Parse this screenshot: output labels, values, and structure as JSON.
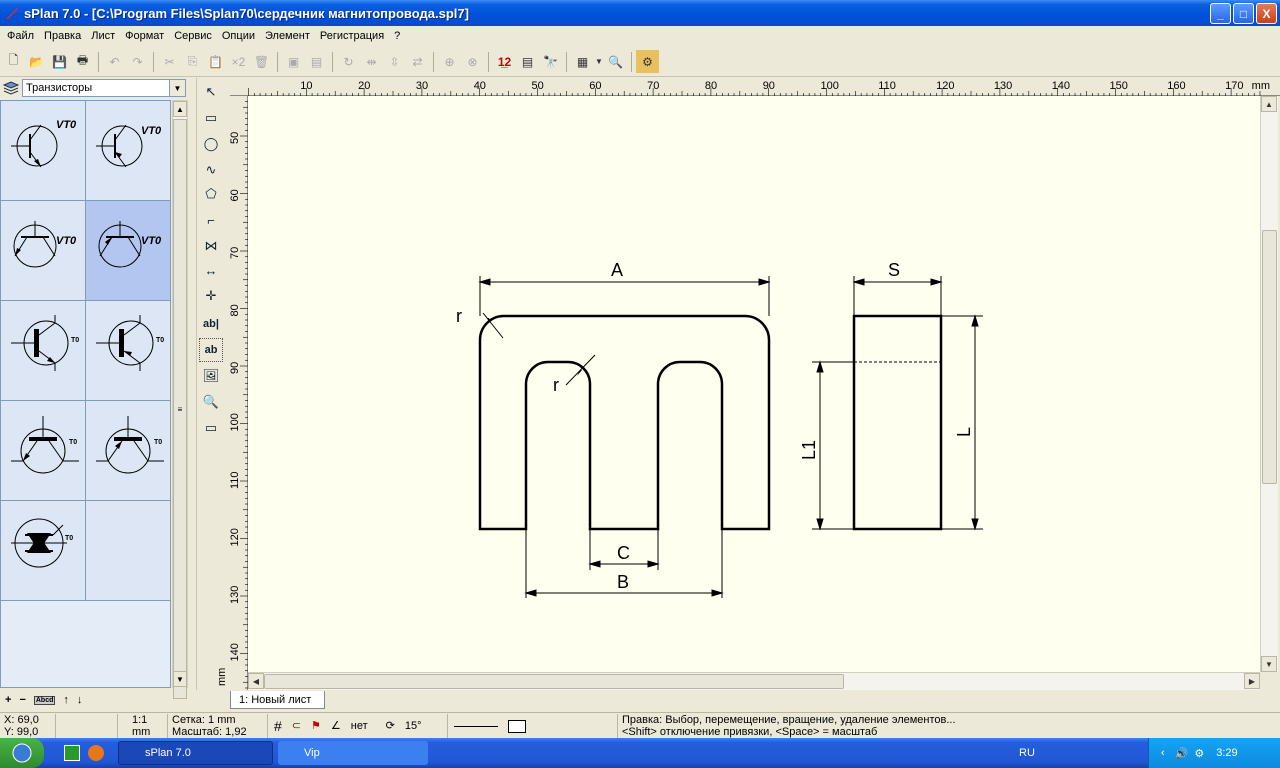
{
  "window": {
    "title": "sPlan 7.0 - [C:\\Program Files\\Splan70\\сердечник магнитопровода.spl7]",
    "min": "_",
    "max": "□",
    "close": "X"
  },
  "menu": [
    "Файл",
    "Правка",
    "Лист",
    "Формат",
    "Сервис",
    "Опции",
    "Элемент",
    "Регистрация",
    "?"
  ],
  "library": {
    "selected": "Транзисторы",
    "cells": [
      {
        "label": "VT0",
        "small": false
      },
      {
        "label": "VT0",
        "small": false
      },
      {
        "label": "VT0",
        "small": false
      },
      {
        "label": "VT0",
        "small": false
      },
      {
        "label": "T0",
        "small": true
      },
      {
        "label": "T0",
        "small": true
      },
      {
        "label": "T0",
        "small": true
      },
      {
        "label": "T0",
        "small": true
      },
      {
        "label": "T0",
        "small": true
      }
    ],
    "footer": [
      "+",
      "−",
      "Abcd",
      "↑",
      "↓"
    ]
  },
  "hruler": {
    "unit": "mm",
    "ticks": [
      "10",
      "20",
      "30",
      "40",
      "50",
      "60",
      "70",
      "80",
      "90",
      "100",
      "110",
      "120",
      "130",
      "140",
      "150",
      "160",
      "170"
    ]
  },
  "vruler": {
    "unit": "mm",
    "ticks": [
      "50",
      "60",
      "70",
      "80",
      "90",
      "100",
      "110",
      "120",
      "130",
      "140"
    ]
  },
  "drawing": {
    "labels": {
      "A": "A",
      "S": "S",
      "r1": "r",
      "r2": "r",
      "C": "C",
      "B": "B",
      "L1": "L1",
      "L": "L"
    }
  },
  "sheet_tab": "1: Новый лист",
  "status": {
    "x": "X: 69,0",
    "y": "Y: 99,0",
    "scale_ratio": "1:1",
    "unit": "mm",
    "grid": "Сетка: 1 mm",
    "zoom": "Масштаб:  1,92",
    "snap": "нет",
    "angle": "15°",
    "help1": "Правка: Выбор, перемещение, вращение, удаление элементов...",
    "help2": "<Shift> отключение привязки, <Space> = масштаб"
  },
  "taskbar": {
    "items": [
      "sPlan 7.0",
      "Vip"
    ],
    "lang": "RU",
    "time": "3:29"
  }
}
